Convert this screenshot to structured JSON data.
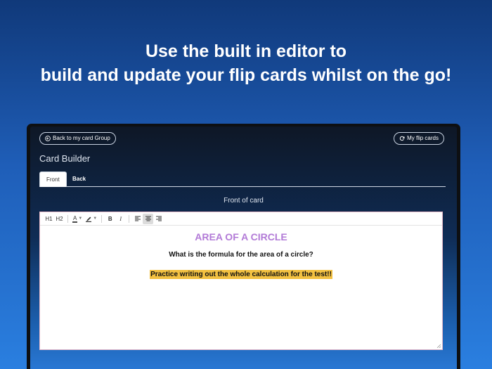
{
  "headline": {
    "line1": "Use the built in editor to",
    "line2": "build and update your flip cards whilst on the go!"
  },
  "app": {
    "back_button": "Back to my card Group",
    "my_flip_cards_button": "My flip cards",
    "page_title": "Card Builder",
    "tabs": [
      {
        "label": "Front",
        "active": true
      },
      {
        "label": "Back",
        "active": false
      }
    ],
    "section_label": "Front of card"
  },
  "toolbar": {
    "h1": "H1",
    "h2": "H2",
    "font_color_glyph": "A",
    "bold": "B",
    "italic": "I",
    "active_alignment": "center"
  },
  "card": {
    "title": "AREA OF A CIRCLE",
    "title_color": "#b27ad7",
    "question": "What is the formula for the area of a circle?",
    "note": "Practice writing out the whole calculation for the test!!",
    "note_highlight_color": "#f3c141"
  }
}
